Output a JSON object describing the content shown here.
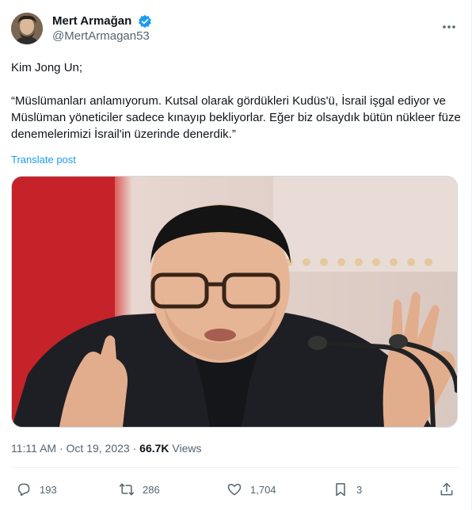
{
  "author": {
    "display_name": "Mert Armağan",
    "handle": "@MertArmagan53"
  },
  "post": {
    "body": "Kim Jong Un;\n\n“Müslümanları anlamıyorum. Kutsal olarak gördükleri Kudüs'ü, İsrail işgal ediyor ve Müslüman yöneticiler sadece kınayıp bekliyorlar. Eğer biz olsaydık bütün nükleer füze denemelerimizi İsrail'in üzerinde denerdik.”",
    "translate_label": "Translate post"
  },
  "meta": {
    "time": "11:11 AM",
    "separator1": " · ",
    "date": "Oct 19, 2023",
    "separator2": " · ",
    "views_count": "66.7K",
    "views_label": " Views"
  },
  "actions": {
    "replies": "193",
    "reposts": "286",
    "likes": "1,704",
    "bookmarks": "3"
  },
  "colors": {
    "accent": "#1d9bf0",
    "secondary_text": "#536471"
  },
  "icons": [
    "verified-badge-icon",
    "more-icon",
    "reply-icon",
    "repost-icon",
    "like-icon",
    "bookmark-icon",
    "share-icon"
  ]
}
